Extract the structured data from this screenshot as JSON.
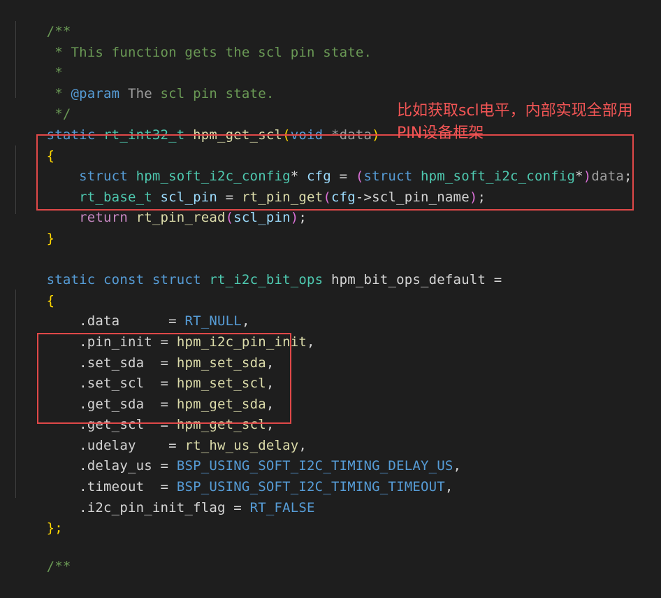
{
  "code": {
    "doc_open": "/**",
    "doc_line1": " * This function gets the scl pin state.",
    "doc_star": " *",
    "doc_param_star": " * ",
    "doc_param_tag": "@param",
    "doc_param_the": " The",
    "doc_param_rest": " scl pin state.",
    "doc_close": " */",
    "fn_static": "static",
    "fn_type": "rt_int32_t",
    "fn_name": "hpm_get_scl",
    "fn_paren_open": "(",
    "fn_void": "void",
    "fn_star_data": " *data",
    "fn_paren_close": ")",
    "brace_open": "{",
    "l1_struct": "struct",
    "l1_type": "hpm_soft_i2c_config",
    "l1_star": "*",
    "l1_var": "cfg",
    "l1_eq": " = ",
    "l1_cast_open": "(",
    "l1_cast_struct": "struct",
    "l1_cast_type": "hpm_soft_i2c_config",
    "l1_cast_star": "*",
    "l1_cast_close": ")",
    "l1_data": "data",
    "l1_semi": ";",
    "l2_type": "rt_base_t",
    "l2_var": "scl_pin",
    "l2_eq": " = ",
    "l2_func": "rt_pin_get",
    "l2_open": "(",
    "l2_cfg": "cfg",
    "l2_arrow": "->",
    "l2_member": "scl_pin_name",
    "l2_close": ")",
    "l2_semi": ";",
    "l3_return": "return",
    "l3_func": "rt_pin_read",
    "l3_open": "(",
    "l3_arg": "scl_pin",
    "l3_close": ")",
    "l3_semi": ";",
    "brace_close": "}",
    "ops_static": "static",
    "ops_const": "const",
    "ops_struct": "struct",
    "ops_type": "rt_i2c_bit_ops",
    "ops_name": "hpm_bit_ops_default",
    "ops_eq": " =",
    "ops_open": "{",
    "f_data_name": ".data",
    "f_data_eq": "      = ",
    "f_data_val": "RT_NULL",
    "f_pin_init_name": ".pin_init",
    "f_pin_init_eq": " = ",
    "f_pin_init_val": "hpm_i2c_pin_init",
    "f_set_sda_name": ".set_sda",
    "f_set_sda_eq": "  = ",
    "f_set_sda_val": "hpm_set_sda",
    "f_set_scl_name": ".set_scl",
    "f_set_scl_eq": "  = ",
    "f_set_scl_val": "hpm_set_scl",
    "f_get_sda_name": ".get_sda",
    "f_get_sda_eq": "  = ",
    "f_get_sda_val": "hpm_get_sda",
    "f_get_scl_name": ".get_scl",
    "f_get_scl_eq": "  = ",
    "f_get_scl_val": "hpm_get_scl",
    "f_udelay_name": ".udelay",
    "f_udelay_eq": "    = ",
    "f_udelay_val": "rt_hw_us_delay",
    "f_delay_us_name": ".delay_us",
    "f_delay_us_eq": " = ",
    "f_delay_us_val": "BSP_USING_SOFT_I2C_TIMING_DELAY_US",
    "f_timeout_name": ".timeout",
    "f_timeout_eq": "  = ",
    "f_timeout_val": "BSP_USING_SOFT_I2C_TIMING_TIMEOUT",
    "f_flag_name": ".i2c_pin_init_flag",
    "f_flag_eq": " = ",
    "f_flag_val": "RT_FALSE",
    "comma": ",",
    "ops_close": "};",
    "next_doc": "/**"
  },
  "annotation": {
    "line1": "比如获取scl电平，内部实现全部用",
    "line2": "PIN设备框架"
  },
  "colors": {
    "background": "#1e1e1e",
    "highlight_box": "#e04848",
    "annotation_text": "#f25555"
  }
}
